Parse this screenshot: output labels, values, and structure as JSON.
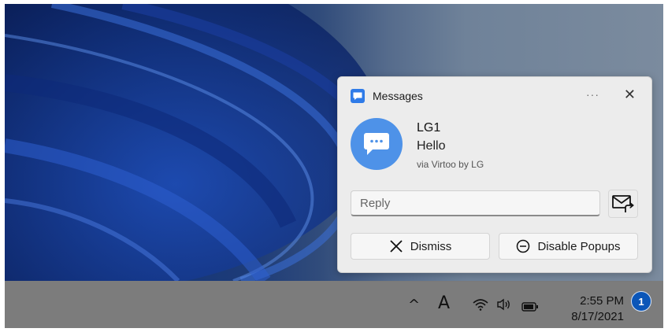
{
  "toast": {
    "app_name": "Messages",
    "more_label": "···",
    "close_label": "✕",
    "sender": "LG1",
    "message": "Hello",
    "via": "via Virtoo by LG",
    "reply_placeholder": "Reply",
    "dismiss_label": "Dismiss",
    "disable_label": "Disable Popups",
    "icons": {
      "app": "message-icon",
      "avatar": "chat-bubble-icon",
      "send": "send-envelope-icon",
      "dismiss": "x-icon",
      "disable": "minus-circle-icon"
    },
    "colors": {
      "accent": "#2f7be8",
      "avatar": "#4e92e8"
    }
  },
  "taskbar": {
    "chevron": "^",
    "input_indicator": "A",
    "time": "2:55 PM",
    "date": "8/17/2021",
    "notification_count": "1",
    "icons": [
      "chevron-up-icon",
      "input-language-icon",
      "wifi-icon",
      "speaker-icon",
      "battery-icon"
    ]
  }
}
